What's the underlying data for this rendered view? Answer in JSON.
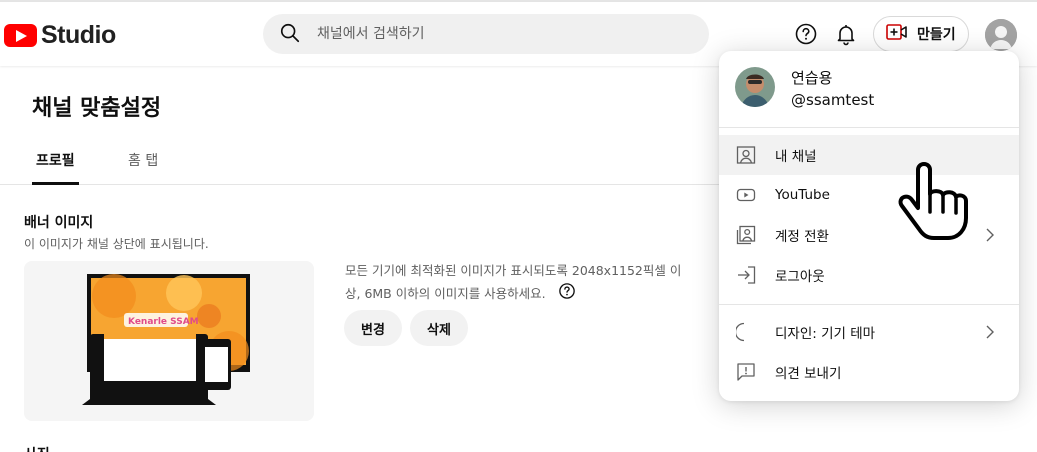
{
  "header": {
    "logo_text": "Studio",
    "search_placeholder": "채널에서 검색하기",
    "create_label": "만들기"
  },
  "page": {
    "title": "채널 맞춤설정",
    "tabs": [
      {
        "label": "프로필",
        "active": true
      },
      {
        "label": "홈 탭",
        "active": false
      }
    ]
  },
  "banner": {
    "title": "배너 이미지",
    "subtitle": "이 이미지가 채널 상단에 표시됩니다.",
    "description": "모든 기기에 최적화된 이미지가 표시되도록 2048x1152픽셀 이상, 6MB 이하의 이미지를 사용하세요.",
    "change_label": "변경",
    "delete_label": "삭제",
    "preview_logo_text": "Kenarle SSAM"
  },
  "next_section_partial": "사진",
  "account_menu": {
    "name": "연습용",
    "handle": "@ssamtest",
    "items": [
      {
        "label": "내 채널",
        "icon": "person-box-icon",
        "highlighted": true
      },
      {
        "label": "YouTube",
        "icon": "youtube-icon"
      },
      {
        "label": "계정 전환",
        "icon": "switch-account-icon",
        "has_submenu": true
      },
      {
        "label": "로그아웃",
        "icon": "sign-out-icon"
      },
      {
        "label": "디자인: 기기 테마",
        "icon": "moon-icon",
        "has_submenu": true
      },
      {
        "label": "의견 보내기",
        "icon": "feedback-icon"
      }
    ]
  },
  "colors": {
    "brand_red": "#ff0000",
    "text_primary": "#0f0f0f",
    "text_secondary": "#606060",
    "hover_bg": "#f2f2f2",
    "banner_orange": "#f7a531"
  }
}
